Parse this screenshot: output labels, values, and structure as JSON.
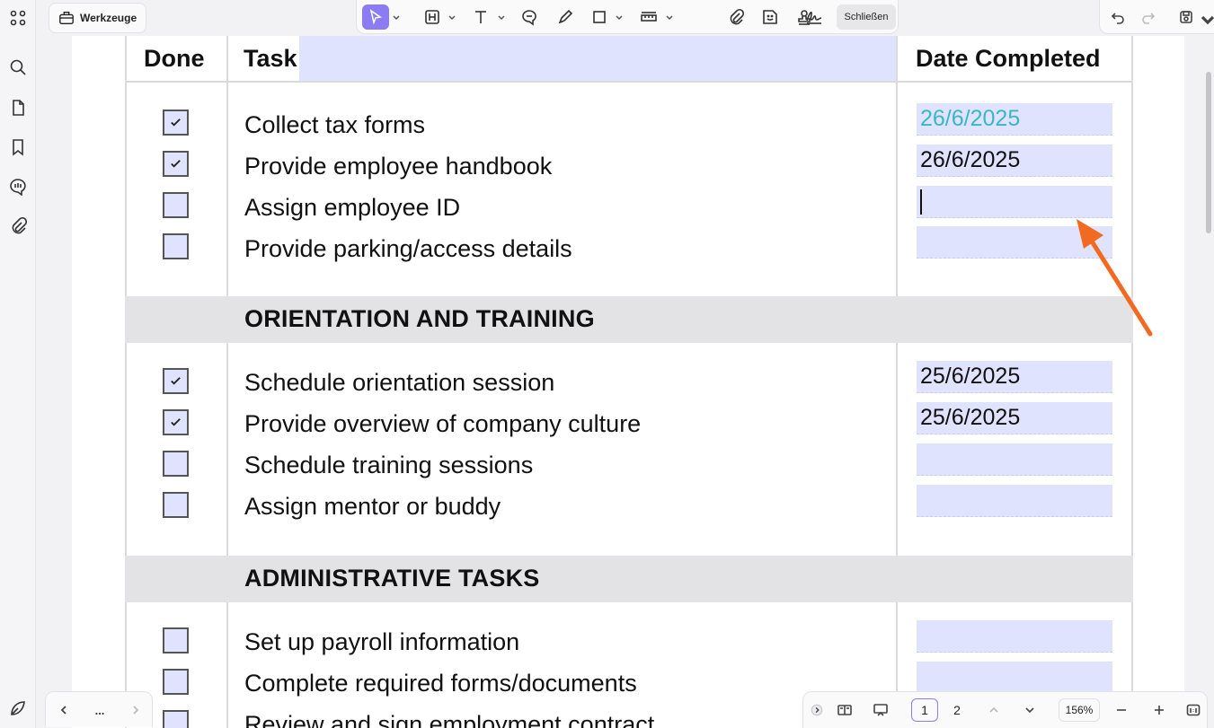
{
  "toolbar": {
    "tools_label": "Werkzeuge",
    "close_label": "Schließen"
  },
  "table": {
    "headers": {
      "done": "Done",
      "task": "Task",
      "date": "Date Completed"
    },
    "sections": [
      {
        "title": "",
        "rows": [
          {
            "checked": true,
            "task": "Collect tax forms",
            "date": "26/6/2025"
          },
          {
            "checked": true,
            "task": "Provide employee handbook",
            "date": "26/6/2025"
          },
          {
            "checked": false,
            "task": "Assign employee ID",
            "date": ""
          },
          {
            "checked": false,
            "task": "Provide parking/access details",
            "date": ""
          }
        ]
      },
      {
        "title": "ORIENTATION AND TRAINING",
        "rows": [
          {
            "checked": true,
            "task": "Schedule orientation session",
            "date": "25/6/2025"
          },
          {
            "checked": true,
            "task": "Provide overview of company culture",
            "date": "25/6/2025"
          },
          {
            "checked": false,
            "task": "Schedule training sessions",
            "date": ""
          },
          {
            "checked": false,
            "task": "Assign mentor or buddy",
            "date": ""
          }
        ]
      },
      {
        "title": "ADMINISTRATIVE TASKS",
        "rows": [
          {
            "checked": false,
            "task": "Set up payroll information",
            "date": ""
          },
          {
            "checked": false,
            "task": "Complete required forms/documents",
            "date": ""
          },
          {
            "checked": false,
            "task": "Review and sign employment contract",
            "date": ""
          }
        ]
      }
    ]
  },
  "bottom_nav": {
    "more_label": "..."
  },
  "pagination": {
    "pages": [
      "1",
      "2"
    ],
    "current": "1",
    "zoom": "156%"
  },
  "colors": {
    "accent": "#8b7cf6",
    "field_fill": "#dfe3fd",
    "section_band": "#e3e3e6",
    "annotation_arrow": "#f26a21",
    "teal_date": "#39b6c9"
  }
}
